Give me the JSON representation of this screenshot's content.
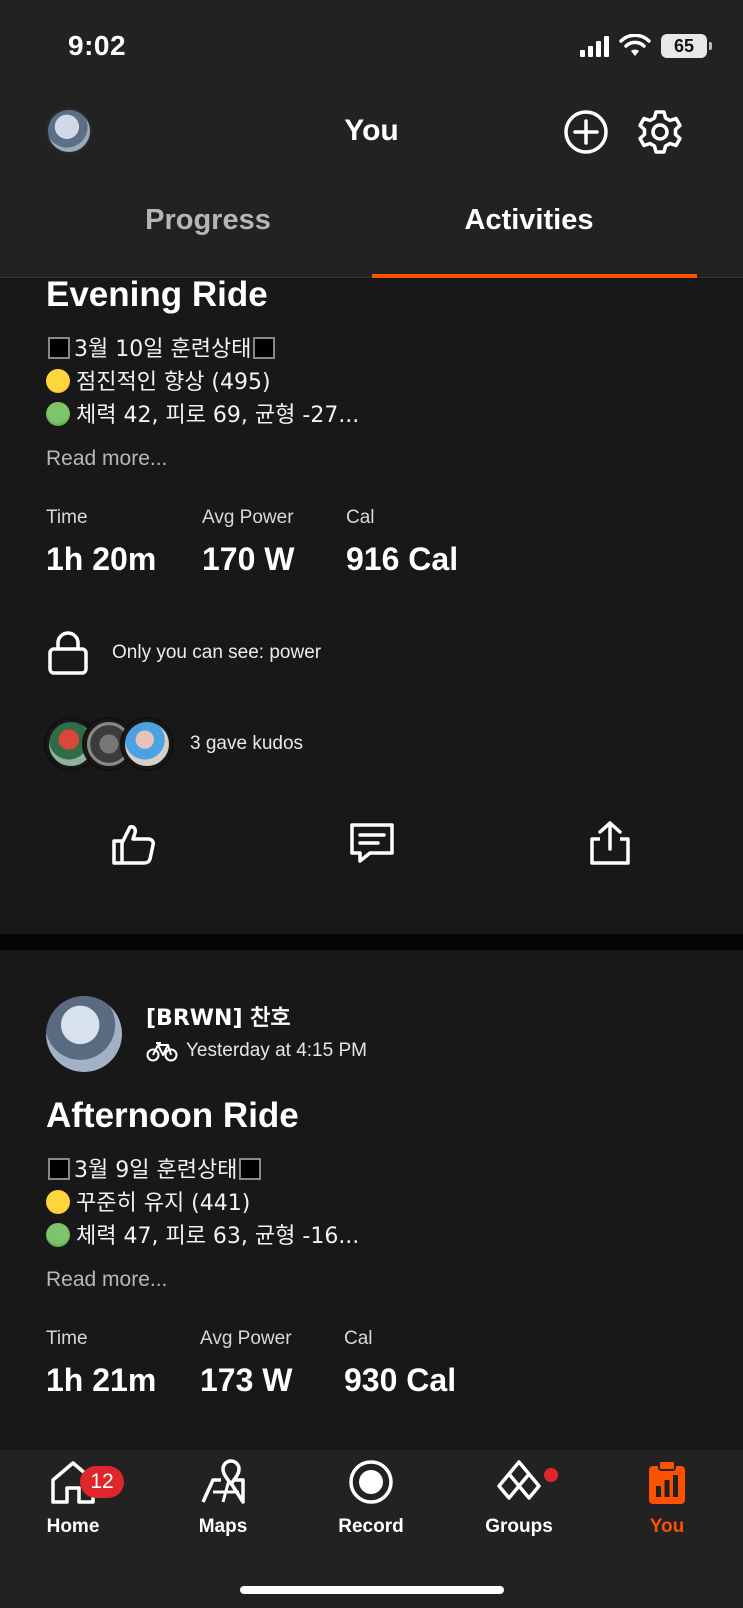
{
  "status_bar": {
    "time": "9:02",
    "battery": "65"
  },
  "header": {
    "title": "You"
  },
  "tabs": [
    {
      "label": "Progress"
    },
    {
      "label": "Activities"
    }
  ],
  "activities": [
    {
      "title": "Evening Ride",
      "description": [
        "3월 10일 훈련상태",
        "점진적인 향상 (495)",
        "체력 42, 피로 69, 균형 -27..."
      ],
      "read_more": "Read more...",
      "stats": [
        {
          "label": "Time",
          "value": "1h 20m"
        },
        {
          "label": "Avg Power",
          "value": "170 W"
        },
        {
          "label": "Cal",
          "value": "916 Cal"
        }
      ],
      "privacy": "Only you can see: power",
      "kudos": "3 gave kudos"
    },
    {
      "athlete": "[BRWN] 찬호",
      "when": "Yesterday at 4:15 PM",
      "title": "Afternoon Ride",
      "description": [
        "3월 9일 훈련상태",
        "꾸준히 유지 (441)",
        "체력 47, 피로 63, 균형 -16..."
      ],
      "read_more": "Read more...",
      "stats": [
        {
          "label": "Time",
          "value": "1h 21m"
        },
        {
          "label": "Avg Power",
          "value": "173 W"
        },
        {
          "label": "Cal",
          "value": "930 Cal"
        }
      ]
    }
  ],
  "bottom_nav": [
    {
      "label": "Home",
      "icon": "home-icon",
      "badge": "12"
    },
    {
      "label": "Maps",
      "icon": "maps-icon"
    },
    {
      "label": "Record",
      "icon": "record-icon"
    },
    {
      "label": "Groups",
      "icon": "groups-icon",
      "dot": true
    },
    {
      "label": "You",
      "icon": "you-icon",
      "active": true
    }
  ],
  "colors": {
    "accent": "#fc5200",
    "badge": "#e0262d",
    "background": "#121212"
  }
}
